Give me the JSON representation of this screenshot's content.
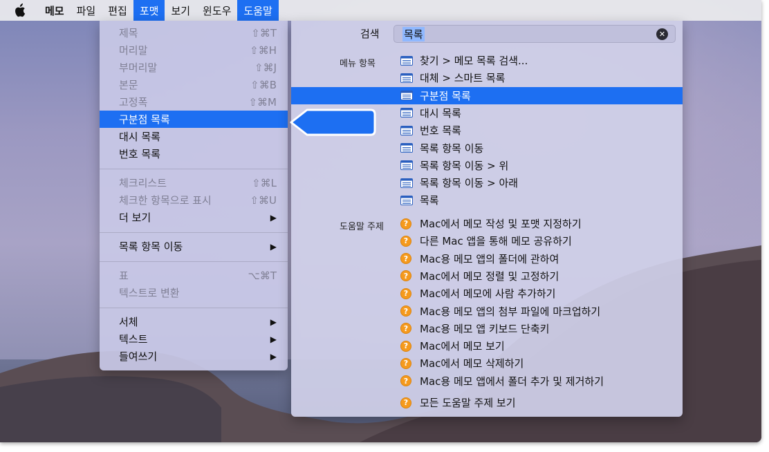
{
  "menubar": {
    "items": [
      {
        "label": "메모",
        "bold": true
      },
      {
        "label": "파일"
      },
      {
        "label": "편집"
      },
      {
        "label": "포맷",
        "active": true
      },
      {
        "label": "보기"
      },
      {
        "label": "윈도우"
      },
      {
        "label": "도움말",
        "active": true
      }
    ]
  },
  "format_menu": {
    "items": [
      {
        "label": "제목",
        "shortcut": "⇧⌘T"
      },
      {
        "label": "머리말",
        "shortcut": "⇧⌘H"
      },
      {
        "label": "부머리말",
        "shortcut": "⇧⌘J"
      },
      {
        "label": "본문",
        "shortcut": "⇧⌘B"
      },
      {
        "label": "고정폭",
        "shortcut": "⇧⌘M"
      },
      {
        "label": "구분점 목록"
      },
      {
        "label": "대시 목록"
      },
      {
        "label": "번호 목록"
      },
      {
        "label": "체크리스트",
        "shortcut": "⇧⌘L"
      },
      {
        "label": "체크한 항목으로 표시",
        "shortcut": "⇧⌘U"
      },
      {
        "label": "더 보기",
        "arrow": "▶"
      },
      {
        "label": "목록 항목 이동",
        "arrow": "▶"
      },
      {
        "label": "표",
        "shortcut": "⌥⌘T"
      },
      {
        "label": "텍스트로 변환"
      },
      {
        "label": "서체",
        "arrow": "▶"
      },
      {
        "label": "텍스트",
        "arrow": "▶"
      },
      {
        "label": "들여쓰기",
        "arrow": "▶"
      }
    ]
  },
  "help_panel": {
    "search_label": "검색",
    "search_value": "목록",
    "clear_symbol": "✕",
    "menu_section_label": "메뉴 항목",
    "menu_items": [
      "찾기 > 메모 목록 검색...",
      "대체 > 스마트 목록",
      "구분점 목록",
      "대시 목록",
      "번호 목록",
      "목록 항목 이동",
      "목록 항목 이동 > 위",
      "목록 항목 이동 > 아래",
      "목록"
    ],
    "topics_section_label": "도움말 주제",
    "topics": [
      "Mac에서 메모 작성 및 포맷 지정하기",
      "다른 Mac 앱을 통해 메모 공유하기",
      "Mac용 메모 앱의 폴더에 관하여",
      "Mac에서 메모 정렬 및 고정하기",
      "Mac에서 메모에 사람 추가하기",
      "Mac용 메모 앱의 첨부 파일에 마크업하기",
      "Mac용 메모 앱 키보드 단축키",
      "Mac에서 메모 보기",
      "Mac에서 메모 삭제하기",
      "Mac용 메모 앱에서 폴더 추가 및 제거하기"
    ],
    "all_topics": "모든 도움말 주제 보기",
    "topic_icon_glyph": "?"
  },
  "colors": {
    "selection": "#1d6ff2",
    "callout": "#1d6ff2",
    "help_icon": "#f59a1d"
  }
}
